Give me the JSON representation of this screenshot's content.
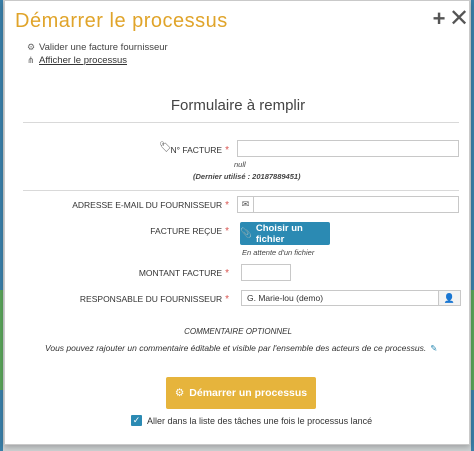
{
  "modal": {
    "title": "Démarrer le processus",
    "plus_icon": "plus-icon",
    "close_icon": "close-icon"
  },
  "subnav": {
    "item1": "Valider une facture fournisseur",
    "item2": "Afficher le processus"
  },
  "form": {
    "title": "Formulaire à remplir",
    "invoice_label": "N° facture",
    "invoice_value": "",
    "invoice_hint_null": "null",
    "invoice_hint_last": "(Dernier utilisé : 20187889451)",
    "email_label": "Adresse e-mail du fournisseur",
    "email_value": "",
    "received_label": "Facture reçue",
    "file_button": "Choisir un fichier",
    "file_hint": "En attente d'un fichier",
    "amount_label": "Montant facture",
    "amount_value": "",
    "responsible_label": "Responsable du fournisseur",
    "responsible_value": "G. Marie-lou (demo)",
    "comment_title": "Commentaire optionnel",
    "comment_text": "Vous pouvez rajouter un commentaire éditable et visible par l'ensemble des acteurs de ce processus.",
    "required_mark": "*"
  },
  "footer": {
    "start_button": "Démarrer un processus",
    "checkbox_label": "Aller dans la liste des tâches une fois le processus lancé",
    "checkbox_checked": true
  },
  "colors": {
    "accent": "#e0a42a",
    "button_primary": "#2b8ab3",
    "button_start": "#e6b43c",
    "required": "#d9534f"
  }
}
